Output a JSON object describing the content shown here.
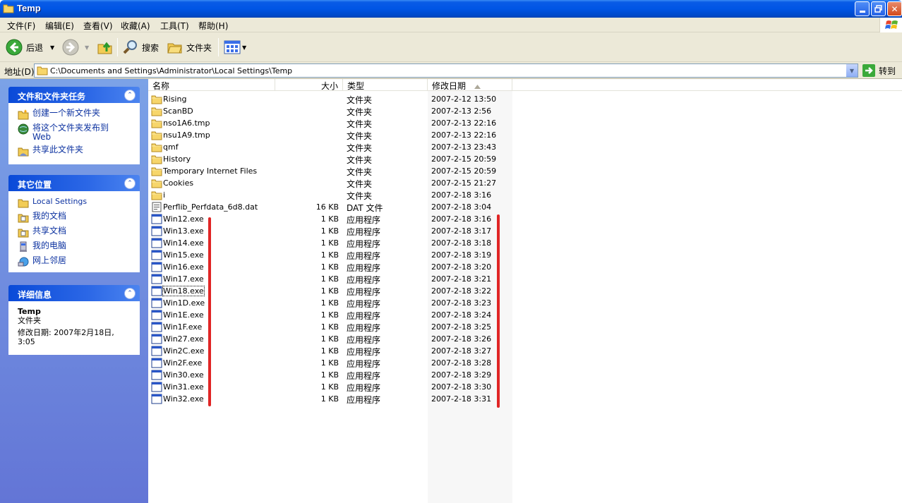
{
  "window": {
    "title": "Temp"
  },
  "menu": [
    "文件(F)",
    "编辑(E)",
    "查看(V)",
    "收藏(A)",
    "工具(T)",
    "帮助(H)"
  ],
  "toolbar": {
    "back": "后退",
    "search": "搜索",
    "folders": "文件夹"
  },
  "address": {
    "label": "地址(D)",
    "path": "C:\\Documents and Settings\\Administrator\\Local Settings\\Temp",
    "go": "转到"
  },
  "panels": {
    "tasks": {
      "title": "文件和文件夹任务",
      "items": [
        "创建一个新文件夹",
        "将这个文件夹发布到 Web",
        "共享此文件夹"
      ]
    },
    "places": {
      "title": "其它位置",
      "items": [
        "Local Settings",
        "我的文档",
        "共享文档",
        "我的电脑",
        "网上邻居"
      ]
    },
    "details": {
      "title": "详细信息",
      "name": "Temp",
      "kind": "文件夹",
      "modified": "修改日期: 2007年2月18日, 3:05"
    }
  },
  "columns": {
    "name": "名称",
    "size": "大小",
    "type": "类型",
    "date": "修改日期"
  },
  "files": [
    {
      "name": "Rising",
      "size": "",
      "type": "文件夹",
      "date": "2007-2-12 13:50",
      "icon": "folder"
    },
    {
      "name": "ScanBD",
      "size": "",
      "type": "文件夹",
      "date": "2007-2-13 2:56",
      "icon": "folder"
    },
    {
      "name": "nso1A6.tmp",
      "size": "",
      "type": "文件夹",
      "date": "2007-2-13 22:16",
      "icon": "folder"
    },
    {
      "name": "nsu1A9.tmp",
      "size": "",
      "type": "文件夹",
      "date": "2007-2-13 22:16",
      "icon": "folder"
    },
    {
      "name": "qmf",
      "size": "",
      "type": "文件夹",
      "date": "2007-2-13 23:43",
      "icon": "folder"
    },
    {
      "name": "History",
      "size": "",
      "type": "文件夹",
      "date": "2007-2-15 20:59",
      "icon": "folder"
    },
    {
      "name": "Temporary Internet Files",
      "size": "",
      "type": "文件夹",
      "date": "2007-2-15 20:59",
      "icon": "folder"
    },
    {
      "name": "Cookies",
      "size": "",
      "type": "文件夹",
      "date": "2007-2-15 21:27",
      "icon": "folder"
    },
    {
      "name": "i",
      "size": "",
      "type": "文件夹",
      "date": "2007-2-18 3:16",
      "icon": "folder"
    },
    {
      "name": "Perflib_Perfdata_6d8.dat",
      "size": "16 KB",
      "type": "DAT 文件",
      "date": "2007-2-18 3:04",
      "icon": "dat"
    },
    {
      "name": "Win12.exe",
      "size": "1 KB",
      "type": "应用程序",
      "date": "2007-2-18 3:16",
      "icon": "exe"
    },
    {
      "name": "Win13.exe",
      "size": "1 KB",
      "type": "应用程序",
      "date": "2007-2-18 3:17",
      "icon": "exe"
    },
    {
      "name": "Win14.exe",
      "size": "1 KB",
      "type": "应用程序",
      "date": "2007-2-18 3:18",
      "icon": "exe"
    },
    {
      "name": "Win15.exe",
      "size": "1 KB",
      "type": "应用程序",
      "date": "2007-2-18 3:19",
      "icon": "exe"
    },
    {
      "name": "Win16.exe",
      "size": "1 KB",
      "type": "应用程序",
      "date": "2007-2-18 3:20",
      "icon": "exe"
    },
    {
      "name": "Win17.exe",
      "size": "1 KB",
      "type": "应用程序",
      "date": "2007-2-18 3:21",
      "icon": "exe"
    },
    {
      "name": "Win18.exe",
      "size": "1 KB",
      "type": "应用程序",
      "date": "2007-2-18 3:22",
      "icon": "exe",
      "focus": true
    },
    {
      "name": "Win1D.exe",
      "size": "1 KB",
      "type": "应用程序",
      "date": "2007-2-18 3:23",
      "icon": "exe"
    },
    {
      "name": "Win1E.exe",
      "size": "1 KB",
      "type": "应用程序",
      "date": "2007-2-18 3:24",
      "icon": "exe"
    },
    {
      "name": "Win1F.exe",
      "size": "1 KB",
      "type": "应用程序",
      "date": "2007-2-18 3:25",
      "icon": "exe"
    },
    {
      "name": "Win27.exe",
      "size": "1 KB",
      "type": "应用程序",
      "date": "2007-2-18 3:26",
      "icon": "exe"
    },
    {
      "name": "Win2C.exe",
      "size": "1 KB",
      "type": "应用程序",
      "date": "2007-2-18 3:27",
      "icon": "exe"
    },
    {
      "name": "Win2F.exe",
      "size": "1 KB",
      "type": "应用程序",
      "date": "2007-2-18 3:28",
      "icon": "exe"
    },
    {
      "name": "Win30.exe",
      "size": "1 KB",
      "type": "应用程序",
      "date": "2007-2-18 3:29",
      "icon": "exe"
    },
    {
      "name": "Win31.exe",
      "size": "1 KB",
      "type": "应用程序",
      "date": "2007-2-18 3:30",
      "icon": "exe"
    },
    {
      "name": "Win32.exe",
      "size": "1 KB",
      "type": "应用程序",
      "date": "2007-2-18 3:31",
      "icon": "exe"
    }
  ],
  "colors": {
    "title_blue": "#0055e5",
    "pane_blue": "#6f8fe0",
    "annotation_red": "#e02525"
  }
}
